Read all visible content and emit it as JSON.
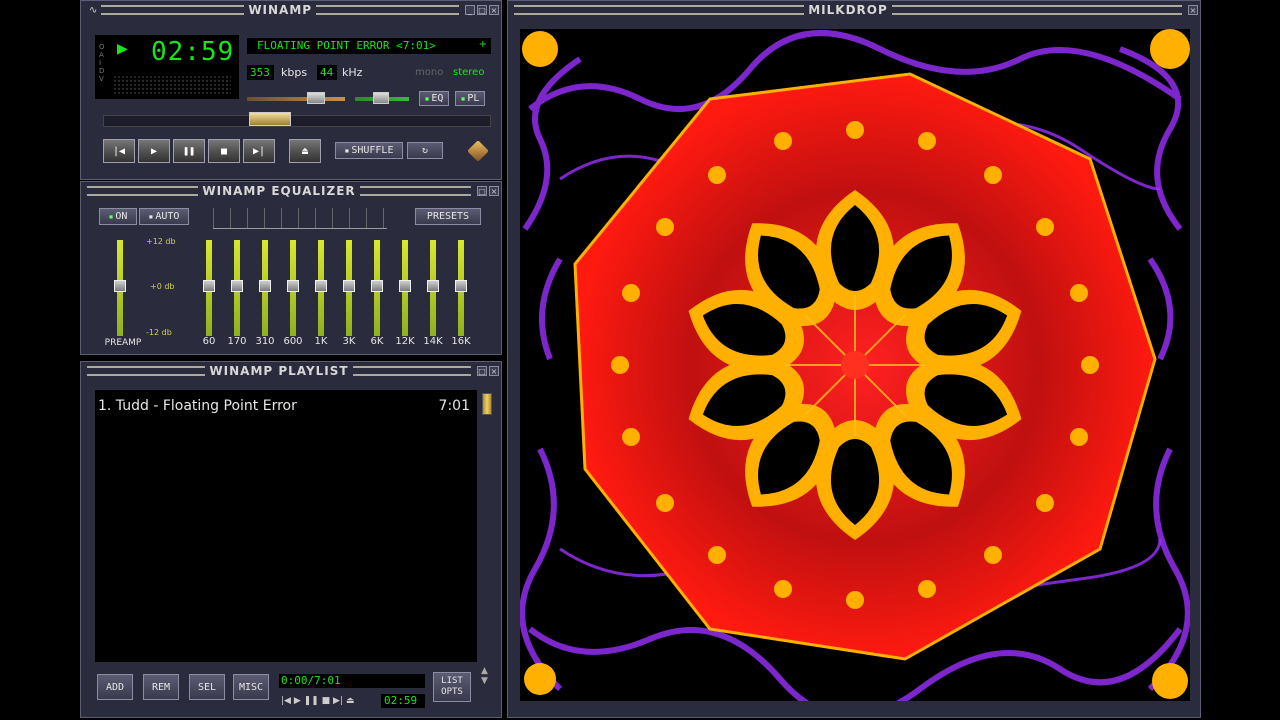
{
  "main": {
    "title": "WINAMP",
    "time": "02:59",
    "ticker": "FLOATING POINT ERROR <7:01>",
    "kbps_value": "353",
    "kbps_unit": "kbps",
    "khz_value": "44",
    "khz_unit": "kHz",
    "mono_label": "mono",
    "stereo_label": "stereo",
    "eq_toggle": "EQ",
    "pl_toggle": "PL",
    "shuffle_label": "SHUFFLE",
    "side_letters": [
      "O",
      "A",
      "I",
      "D",
      "V"
    ]
  },
  "equalizer": {
    "title": "WINAMP EQUALIZER",
    "on_label": "ON",
    "auto_label": "AUTO",
    "presets_label": "PRESETS",
    "db_top": "+12 db",
    "db_mid": "+0 db",
    "db_bot": "-12 db",
    "preamp_label": "PREAMP",
    "bands": [
      "60",
      "170",
      "310",
      "600",
      "1K",
      "3K",
      "6K",
      "12K",
      "14K",
      "16K"
    ]
  },
  "playlist": {
    "title": "WINAMP PLAYLIST",
    "items": [
      {
        "label": "1. Tudd - Floating Point Error",
        "duration": "7:01"
      }
    ],
    "add_label": "ADD",
    "rem_label": "REM",
    "sel_label": "SEL",
    "misc_label": "MISC",
    "list_opts_line1": "LIST",
    "list_opts_line2": "OPTS",
    "position": "0:00/7:01",
    "mini_time": "02:59"
  },
  "milkdrop": {
    "title": "MILKDROP"
  },
  "colors": {
    "lcd_green": "#17e617",
    "frame": "#2b2b3e",
    "eq_bar": "#d8e830"
  }
}
